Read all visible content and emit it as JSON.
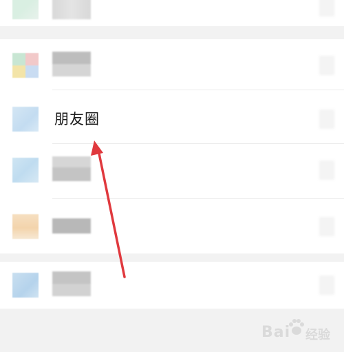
{
  "menu": {
    "moments_label": "朋友圈"
  },
  "watermark": {
    "brand": "Bai",
    "suffix": "经验"
  },
  "colors": {
    "background": "#f2f2f2",
    "surface": "#ffffff",
    "divider": "#ececec",
    "arrow": "#e0393e"
  }
}
